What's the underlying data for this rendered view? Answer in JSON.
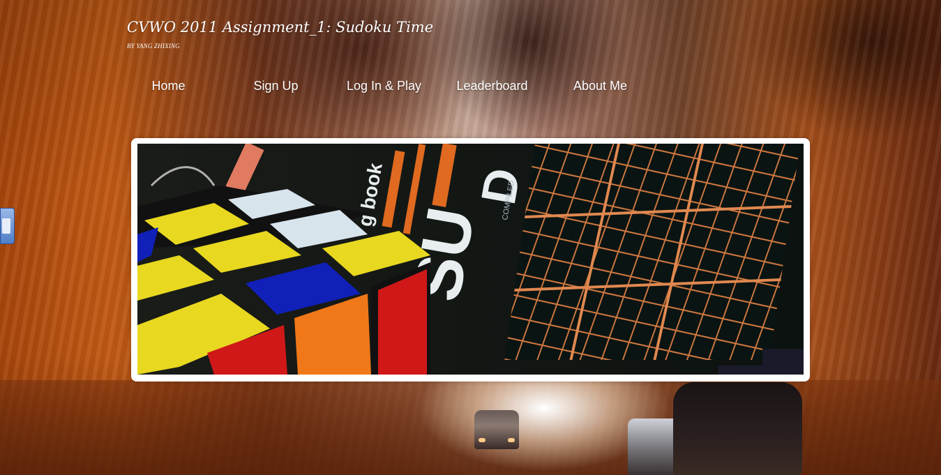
{
  "header": {
    "title": "CVWO 2011 Assignment_1: Sudoku Time",
    "byline": "BY YANG ZHIXING"
  },
  "nav": {
    "items": [
      {
        "label": "Home"
      },
      {
        "label": "Sign Up"
      },
      {
        "label": "Log In & Play"
      },
      {
        "label": "Leaderboard"
      },
      {
        "label": "About Me"
      }
    ]
  },
  "banner": {
    "book_text_1": "g book",
    "book_text_2": "SU",
    "book_text_3": "D",
    "book_text_4": "COMPILED",
    "colors": {
      "cube_yellow": "#e8d820",
      "cube_blue": "#1020b8",
      "cube_red": "#d01818",
      "cube_orange": "#f07818",
      "cube_white": "#d8e4ec",
      "grid_orange": "#d07840",
      "book_black": "#0c1210"
    }
  },
  "side_widget": {
    "icon": "toolbar-widget-icon"
  }
}
